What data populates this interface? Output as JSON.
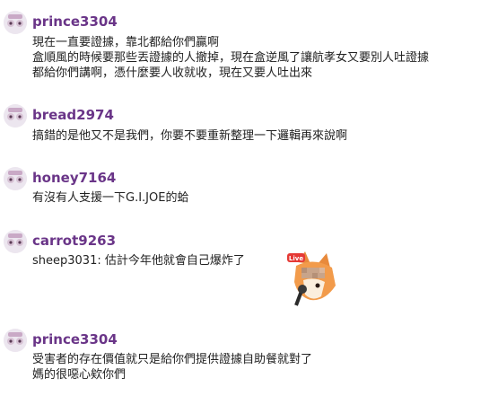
{
  "colors": {
    "username": "#6a3588",
    "text": "#222222",
    "background": "#ffffff"
  },
  "comments": [
    {
      "username": "prince3304",
      "avatar_icon": "user-avatar-icon",
      "lines": [
        "現在一直要證據，靠北都給你們贏啊",
        "盒順風的時候要那些丟證據的人撤掉，現在盒逆風了讓航孝女又要別人吐證據",
        "都給你們講啊，憑什麼要人收就收，現在又要人吐出來"
      ]
    },
    {
      "username": "bread2974",
      "avatar_icon": "user-avatar-icon",
      "lines": [
        "搞錯的是他又不是我們，你要不要重新整理一下邏輯再來說啊"
      ]
    },
    {
      "username": "honey7164",
      "avatar_icon": "user-avatar-icon",
      "lines": [
        "有沒有人支援一下G.I.JOE的蛤"
      ]
    },
    {
      "username": "carrot9263",
      "avatar_icon": "user-avatar-icon",
      "lines": [
        "sheep3031: 估計今年他就會自己爆炸了"
      ],
      "sticker": {
        "icon": "fox-live-sticker-icon",
        "badge": "Live"
      }
    },
    {
      "username": "prince3304",
      "avatar_icon": "user-avatar-icon",
      "lines": [
        "受害者的存在價值就只是給你們提供證據自助餐就對了",
        "媽的很噁心欸你們"
      ]
    }
  ]
}
